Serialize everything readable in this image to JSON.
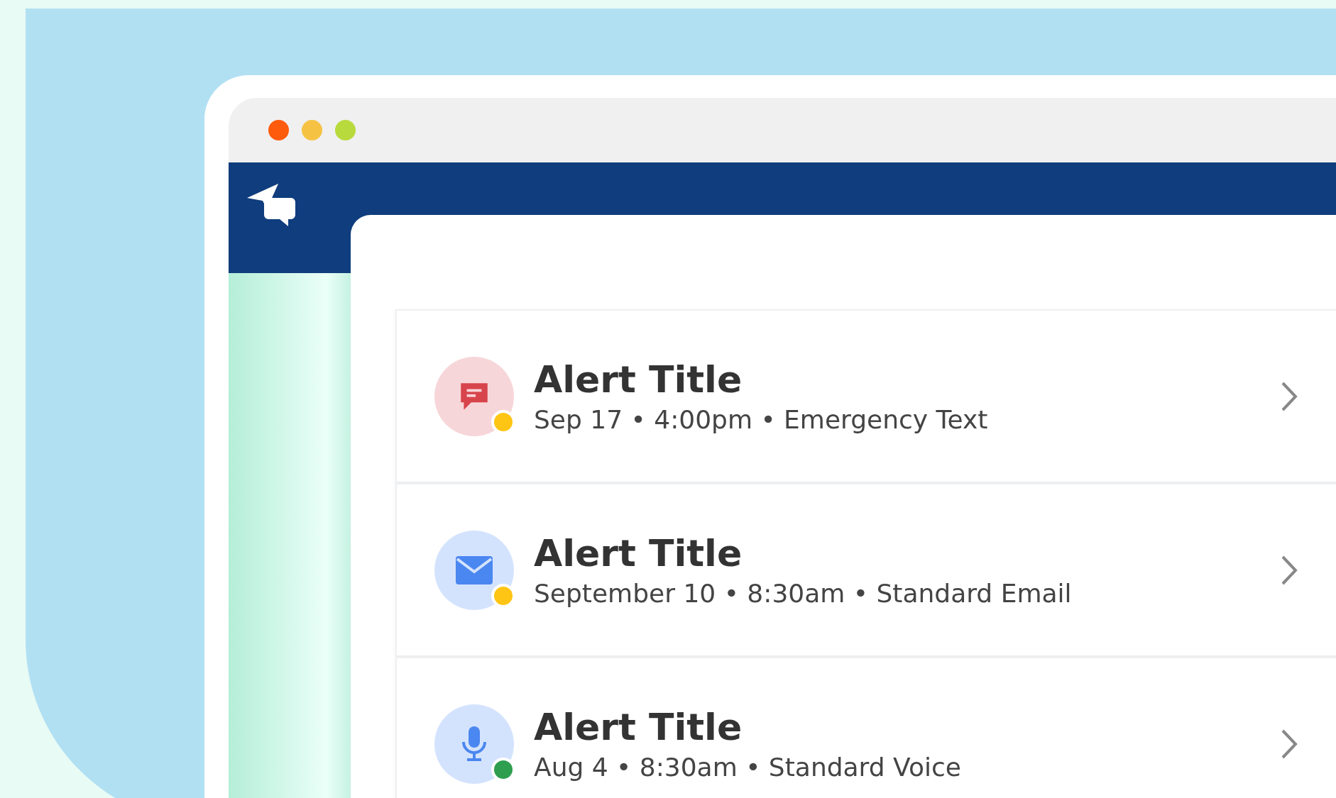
{
  "window": {
    "controls": [
      {
        "color": "#ff5b0c"
      },
      {
        "color": "#f6c244"
      },
      {
        "color": "#b9da3d"
      }
    ]
  },
  "alerts": [
    {
      "kind": "text",
      "title": "Alert Title",
      "meta": "Sep 17 • 4:00pm • Emergency Text",
      "color": "#ffc514"
    },
    {
      "kind": "email",
      "title": "Alert Title",
      "meta": "September 10 • 8:30am • Standard Email",
      "color": "#ffc514"
    },
    {
      "kind": "voice",
      "title": "Alert Title",
      "meta": "Aug 4 • 8:30am • Standard Voice",
      "color": "#2e9e4f"
    }
  ]
}
